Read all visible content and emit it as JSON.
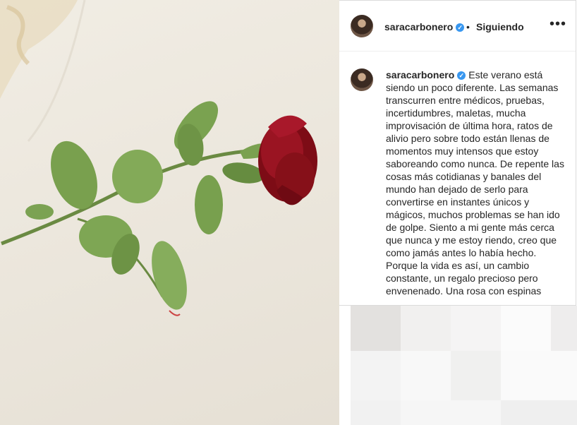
{
  "post": {
    "username": "saracarbonero",
    "separator": "•",
    "follow_status": "Siguiendo",
    "more_icon": "•••",
    "verified_icon": "✓",
    "caption": "Este verano está siendo un poco diferente. Las semanas transcurren entre médicos, pruebas, incertidumbres, maletas, mucha improvisación de última hora, ratos de alivio pero sobre todo están llenas de momentos muy intensos que estoy saboreando como nunca. De repente las cosas más cotidianas y banales del mundo han dejado de serlo para convertirse en instantes únicos y mágicos, muchos problemas se han ido de golpe. Siento a mi gente más cerca que nunca y me estoy riendo, creo que como jamás antes lo había hecho. Porque la vida es así, un cambio constante, un regalo precioso pero envenenado. Una rosa con espinas"
  },
  "icons": [
    "verified-badge-icon",
    "more-options-icon",
    "avatar"
  ],
  "colors": {
    "verified": "#3897f0",
    "rose": "#8e0f1a",
    "leaf": "#6f9a4a"
  }
}
